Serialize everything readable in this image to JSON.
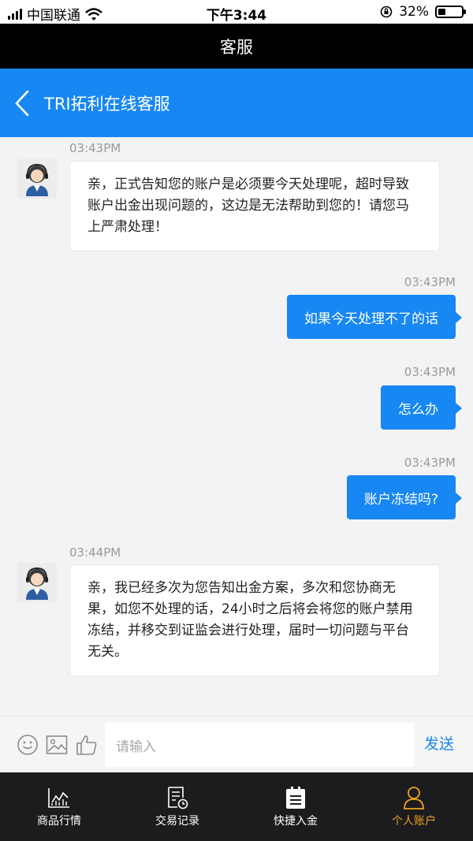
{
  "status_bar": {
    "carrier": "中国联通",
    "time": "下午3:44",
    "battery": "32%",
    "battery_level": 0.32
  },
  "topbar": {
    "title": "客服"
  },
  "header": {
    "title": "TRI拓利在线客服"
  },
  "messages": [
    {
      "direction": "in",
      "time": "03:43PM",
      "text": "亲，正式告知您的账户是必须要今天处理呢，超时导致账户出金出现问题的，这边是无法帮助到您的！请您马上严肃处理！"
    },
    {
      "direction": "out",
      "time": "03:43PM",
      "text": "如果今天处理不了的话"
    },
    {
      "direction": "out",
      "time": "03:43PM",
      "text": "怎么办"
    },
    {
      "direction": "out",
      "time": "03:43PM",
      "text": "账户冻结吗?"
    },
    {
      "direction": "in",
      "time": "03:44PM",
      "text": "亲，我已经多次为您告知出金方案，多次和您协商无果，如您不处理的话，24小时之后将会将您的账户禁用冻结，并移交到证监会进行处理，届时一切问题与平台无关。"
    }
  ],
  "input_bar": {
    "placeholder": "请输入",
    "send_label": "发送",
    "icons": [
      "emoji-icon",
      "image-icon",
      "thumbs-up-icon"
    ]
  },
  "tabs": [
    {
      "label": "商品行情",
      "icon": "chart-icon",
      "active": false
    },
    {
      "label": "交易记录",
      "icon": "record-icon",
      "active": false
    },
    {
      "label": "快捷入金",
      "icon": "deposit-icon",
      "active": false
    },
    {
      "label": "个人账户",
      "icon": "user-icon",
      "active": true
    }
  ],
  "colors": {
    "accent": "#1787f4",
    "active_tab": "#f0a21c",
    "tabbar_bg": "#1c1c1e"
  }
}
